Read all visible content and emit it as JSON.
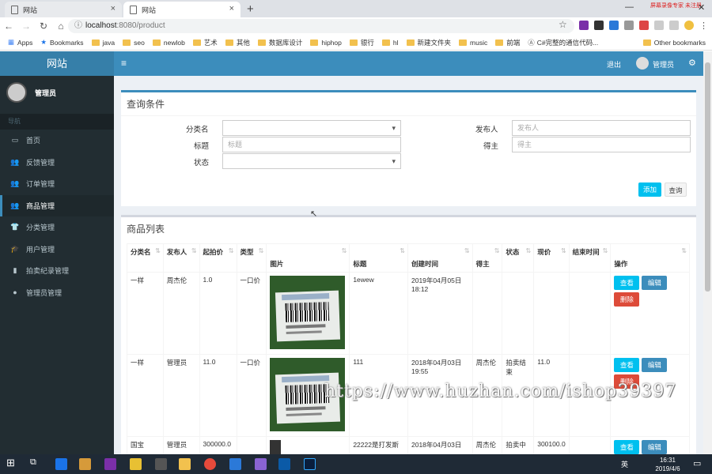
{
  "browser": {
    "tabs": [
      {
        "title": "网站"
      },
      {
        "title": "网站"
      }
    ],
    "url_host": "localhost",
    "url_path": ":8080/product",
    "recorder_text": "屏幕录像专家 未注册",
    "bookmarks": [
      "Apps",
      "Bookmarks",
      "java",
      "seo",
      "newlob",
      "艺术",
      "其他",
      "数据库设计",
      "hiphop",
      "银行",
      "hl",
      "新建文件夹",
      "music",
      "前端",
      "C#完整的通信代码..."
    ],
    "other_bookmarks": "Other bookmarks"
  },
  "sidebar": {
    "brand": "网站",
    "user": "管理员",
    "nav_header": "导航",
    "items": [
      {
        "label": "首页",
        "icon": "monitor-icon"
      },
      {
        "label": "反馈管理",
        "icon": "users-icon"
      },
      {
        "label": "订单管理",
        "icon": "users-icon"
      },
      {
        "label": "商品管理",
        "icon": "users-icon"
      },
      {
        "label": "分类管理",
        "icon": "shirt-icon"
      },
      {
        "label": "用户管理",
        "icon": "graduation-icon"
      },
      {
        "label": "拍卖纪录管理",
        "icon": "book-icon"
      },
      {
        "label": "管理员管理",
        "icon": "user-icon"
      }
    ]
  },
  "topbar": {
    "logout": "退出",
    "user": "管理员"
  },
  "query": {
    "title": "查询条件",
    "category_label": "分类名",
    "publisher_label": "发布人",
    "publisher_placeholder": "发布人",
    "title_label": "标题",
    "title_placeholder": "标题",
    "winner_label": "得主",
    "winner_placeholder": "得主",
    "status_label": "状态",
    "add_button": "添加",
    "query_button": "查询"
  },
  "list": {
    "title": "商品列表",
    "columns": [
      "分类名",
      "发布人",
      "起拍价",
      "类型",
      "图片",
      "标题",
      "创建时间",
      "得主",
      "状态",
      "现价",
      "结束时间",
      "操作"
    ],
    "rows": [
      {
        "category": "一样",
        "publisher": "周杰伦",
        "start_price": "1.0",
        "type": "一口价",
        "title": "1ewew",
        "created": "2019年04月05日 18:12",
        "winner": "",
        "status": "",
        "current": "",
        "end": ""
      },
      {
        "category": "一样",
        "publisher": "管理员",
        "start_price": "11.0",
        "type": "一口价",
        "title": "111",
        "created": "2018年04月03日 19:55",
        "winner": "周杰伦",
        "status": "拍卖结束",
        "current": "11.0",
        "end": ""
      },
      {
        "category": "国宝",
        "publisher": "管理员",
        "start_price": "300000.0",
        "type": "",
        "title": "22222是打发斯",
        "created": "2018年04月03日",
        "winner": "周杰伦",
        "status": "拍卖中",
        "current": "300100.0",
        "end": ""
      }
    ],
    "view_label": "查看",
    "edit_label": "编辑",
    "delete_label": "删除"
  },
  "taskbar": {
    "time": "16:31",
    "date": "2019/4/6",
    "ime": "英"
  },
  "watermark": "https://www.huzhan.com/ishop39397"
}
